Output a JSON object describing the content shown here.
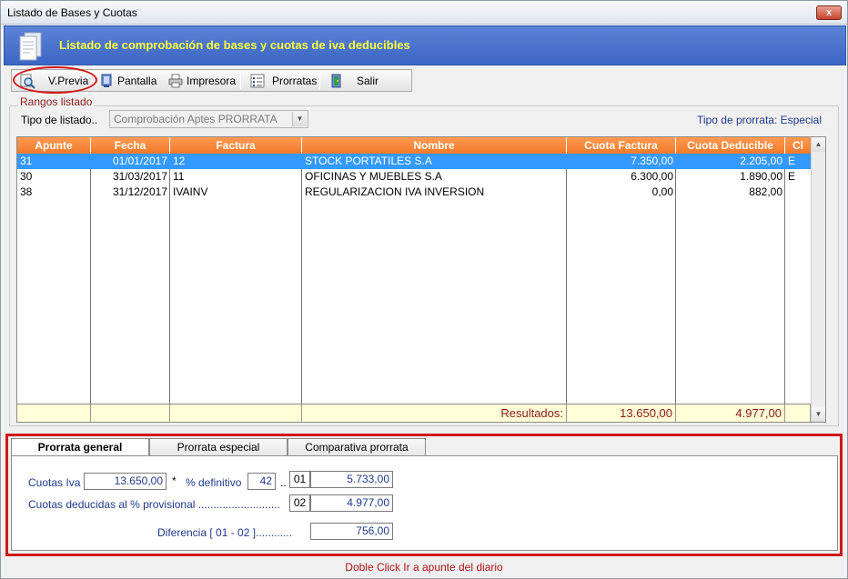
{
  "window": {
    "title": "Listado de Bases y Cuotas",
    "close_label": "x"
  },
  "banner": {
    "heading": "Listado de comprobación de bases y cuotas de iva deducibles"
  },
  "toolbar": {
    "previa": "V.Previa",
    "pantalla": "Pantalla",
    "impresora": "Impresora",
    "prorratas": "Prorratas",
    "salir": "Salir"
  },
  "rangos": {
    "legend": "Rangos listado",
    "tipo_label": "Tipo de listado..",
    "tipo_value": "Comprobación Aptes PRORRATA",
    "prorrata_type": "Tipo de prorrata: Especial"
  },
  "grid": {
    "columns": [
      "Apunte",
      "Fecha",
      "Factura",
      "Nombre",
      "Cuota Factura",
      "Cuota Deducible",
      "Cl"
    ],
    "rows": [
      {
        "apunte": "31",
        "fecha": "01/01/2017",
        "factura": "12",
        "nombre": "STOCK PORTATILES S.A",
        "cuota_factura": "7.350,00",
        "cuota_deducible": "2.205,00",
        "cl": "E"
      },
      {
        "apunte": "30",
        "fecha": "31/03/2017",
        "factura": "11",
        "nombre": "OFICINAS Y MUEBLES S.A",
        "cuota_factura": "6.300,00",
        "cuota_deducible": "1.890,00",
        "cl": "E"
      },
      {
        "apunte": "38",
        "fecha": "31/12/2017",
        "factura": "IVAINV",
        "nombre": "REGULARIZACION IVA INVERSION",
        "cuota_factura": "0,00",
        "cuota_deducible": "882,00",
        "cl": ""
      }
    ],
    "footer": {
      "label": "Resultados:",
      "cuota_factura": "13.650,00",
      "cuota_deducible": "4.977,00"
    }
  },
  "tabs": [
    "Prorrata general",
    "Prorrata especial",
    "Comparativa prorrata"
  ],
  "panel": {
    "cuotas_iva_label": "Cuotas Iva",
    "cuotas_iva_value": "13.650,00",
    "times": "*",
    "definitivo_label": "% definitivo",
    "definitivo_value": "42",
    "dots": "..",
    "code_01": "01",
    "result_01": "5.733,00",
    "deducidas_label": "Cuotas deducidas al % provisional ...........................",
    "code_02": "02",
    "result_02": "4.977,00",
    "diferencia_label": "Diferencia [ 01 - 02 ]............",
    "diferencia_value": "756,00"
  },
  "status": "Doble Click Ir a apunte del diario"
}
